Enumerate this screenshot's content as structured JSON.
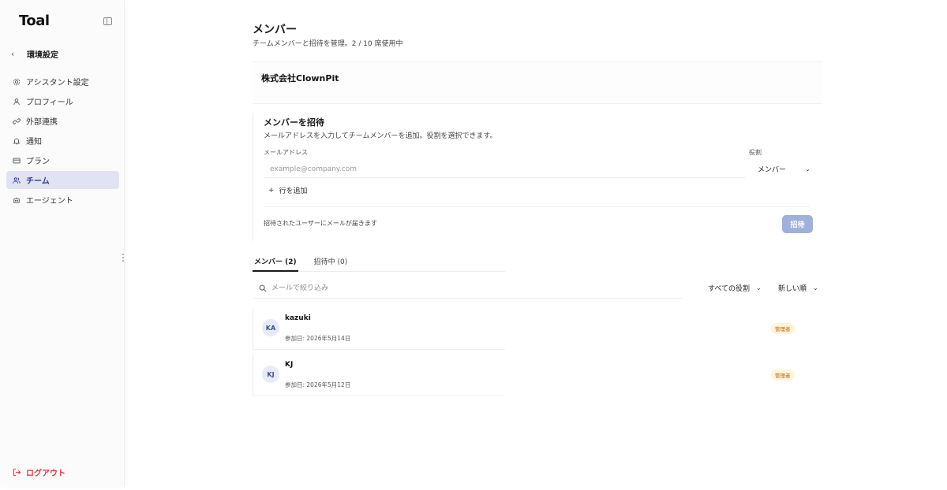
{
  "sidebar": {
    "logo": "Toal",
    "back_label": "環境設定",
    "items": [
      {
        "label": "アシスタント設定",
        "icon": "gear-icon"
      },
      {
        "label": "プロフィール",
        "icon": "user-icon"
      },
      {
        "label": "外部連携",
        "icon": "link-icon"
      },
      {
        "label": "通知",
        "icon": "bell-icon"
      },
      {
        "label": "プラン",
        "icon": "card-icon"
      },
      {
        "label": "チーム",
        "icon": "users-icon",
        "active": true
      },
      {
        "label": "エージェント",
        "icon": "robot-icon"
      }
    ],
    "logout_label": "ログアウト"
  },
  "header": {
    "title": "メンバー",
    "subtitle": "チームメンバーと招待を管理。2 / 10 席使用中"
  },
  "org": {
    "name": "株式会社ClownPit"
  },
  "invite": {
    "title": "メンバーを招待",
    "description": "メールアドレスを入力してチームメンバーを追加。役割を選択できます。",
    "email_label": "メールアドレス",
    "email_placeholder": "example@company.com",
    "role_label": "役割",
    "role_value": "メンバー",
    "add_row_label": "行を追加",
    "note": "招待されたユーザーにメールが届きます",
    "button_label": "招待"
  },
  "tabs": [
    {
      "label": "メンバー (2)",
      "active": true
    },
    {
      "label": "招待中 (0)",
      "active": false
    }
  ],
  "filters": {
    "search_placeholder": "メールで絞り込み",
    "role_filter": "すべての役割",
    "sort": "新しい順"
  },
  "members": [
    {
      "initials": "KA",
      "name": "kazuki",
      "joined": "参加日: 2026年5月14日",
      "role_badge": "管理者"
    },
    {
      "initials": "KJ",
      "name": "KJ",
      "joined": "参加日: 2026年5月12日",
      "role_badge": "管理者"
    }
  ],
  "colors": {
    "accent": "#2e3a8c",
    "active_bg": "#e1e3f2",
    "invite_button": "#9fb0db",
    "logout": "#d83a34",
    "badge_bg": "#fff3d9",
    "badge_text": "#b7650b"
  }
}
